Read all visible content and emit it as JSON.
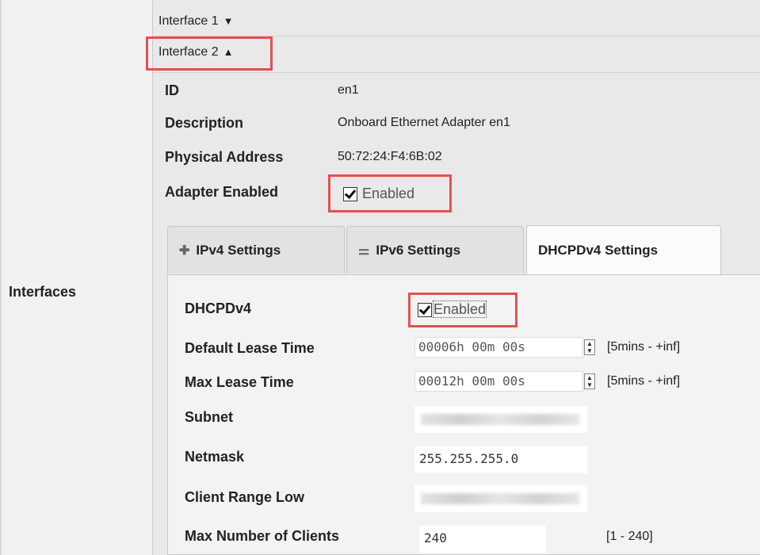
{
  "left": {
    "interfaces_label": "Interfaces"
  },
  "interfaces": [
    {
      "label": "Interface 1",
      "arrow": "▼",
      "expanded": false
    },
    {
      "label": "Interface 2",
      "arrow": "▲",
      "expanded": true
    }
  ],
  "interface2": {
    "id_label": "ID",
    "id_value": "en1",
    "description_label": "Description",
    "description_value": "Onboard Ethernet Adapter en1",
    "physical_label": "Physical Address",
    "physical_value": "50:72:24:F4:6B:02",
    "adapter_enabled_label": "Adapter Enabled",
    "adapter_enabled_text": "Enabled",
    "adapter_enabled_checked": true
  },
  "tabs": [
    {
      "label": "IPv4 Settings",
      "icon": "plug-icon",
      "active": false
    },
    {
      "label": "IPv6 Settings",
      "icon": "plug-pair-icon",
      "active": false
    },
    {
      "label": "DHCPDv4 Settings",
      "icon": "",
      "active": true
    }
  ],
  "dhcp": {
    "dhcpdv4_label": "DHCPDv4",
    "dhcpdv4_text": "Enabled",
    "dhcpdv4_checked": true,
    "default_lease_label": "Default Lease Time",
    "default_lease_value": "00006h 00m 00s",
    "default_lease_range": "[5mins - +inf]",
    "max_lease_label": "Max Lease Time",
    "max_lease_value": "00012h 00m 00s",
    "max_lease_range": "[5mins - +inf]",
    "subnet_label": "Subnet",
    "netmask_label": "Netmask",
    "netmask_value": "255.255.255.0",
    "client_low_label": "Client Range Low",
    "max_clients_label": "Max Number of Clients",
    "max_clients_value": "240",
    "max_clients_range": "[1 - 240]"
  },
  "colors": {
    "highlight": "#e05252",
    "panel_bg": "#f3f3f3"
  }
}
